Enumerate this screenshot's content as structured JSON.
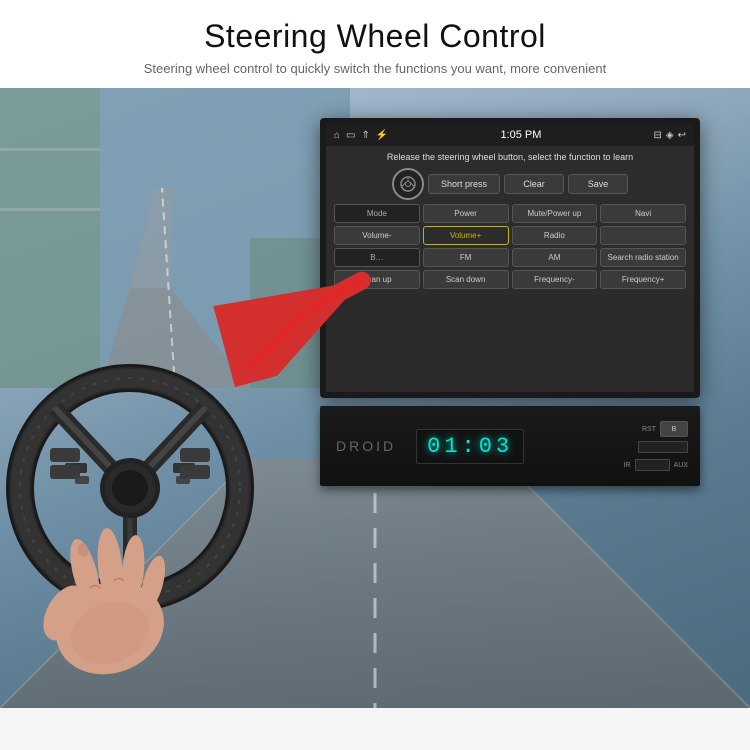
{
  "header": {
    "title": "Steering Wheel Control",
    "subtitle": "Steering wheel control to quickly switch the functions you want, more convenient"
  },
  "screen": {
    "status_bar": {
      "time": "1:05 PM",
      "icons_left": [
        "home",
        "screen",
        "up-arrows",
        "usb"
      ],
      "icons_right": [
        "cast",
        "location",
        "back"
      ]
    },
    "instruction": "Release the steering wheel button, select the function to learn",
    "top_buttons": {
      "short_press": "Short press",
      "clear": "Clear",
      "save": "Save"
    },
    "grid_buttons": [
      "Mode",
      "Power",
      "Mute/Power up",
      "Navi",
      "Volume-",
      "Volume+",
      "Radio",
      "",
      "B…",
      "FM",
      "AM",
      "Search radio station",
      "Scan up",
      "Scan down",
      "Frequency-",
      "Frequency+"
    ],
    "highlighted_button": "Volume+",
    "digital_time": "01:03"
  },
  "colors": {
    "accent": "#c8b400",
    "digital_display": "#00e5cc",
    "screen_bg": "#2c2c2c",
    "button_bg": "#3a3a3a",
    "arrow_red": "#d32f2f"
  }
}
